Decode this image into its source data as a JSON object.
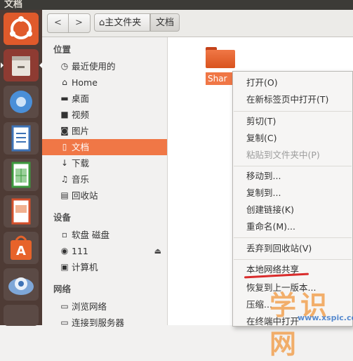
{
  "window": {
    "title": "文档"
  },
  "launcher": {
    "items": [
      {
        "name": "ubuntu-dash-icon",
        "bg": "#e05a2b"
      },
      {
        "name": "files-icon",
        "bg": "#8e3b32"
      },
      {
        "name": "chromium-icon",
        "bg": "#5b4a45"
      },
      {
        "name": "writer-icon",
        "bg": "#3e73b6"
      },
      {
        "name": "calc-icon",
        "bg": "#3d9a3e"
      },
      {
        "name": "impress-icon",
        "bg": "#d4502c"
      },
      {
        "name": "software-center-icon",
        "bg": "#e7632a"
      },
      {
        "name": "system-settings-icon",
        "bg": "#7ea7d8"
      }
    ]
  },
  "toolbar": {
    "back": "<",
    "forward": ">",
    "breadcrumb_home": "主文件夹",
    "breadcrumb_current": "文档"
  },
  "sidebar": {
    "places_header": "位置",
    "devices_header": "设备",
    "network_header": "网络",
    "places": [
      {
        "icon": "◷",
        "label": "最近使用的"
      },
      {
        "icon": "⌂",
        "label": "Home"
      },
      {
        "icon": "▬",
        "label": "桌面"
      },
      {
        "icon": "■",
        "label": "视频"
      },
      {
        "icon": "◙",
        "label": "图片"
      },
      {
        "icon": "▯",
        "label": "文档"
      },
      {
        "icon": "↓",
        "label": "下载"
      },
      {
        "icon": "♫",
        "label": "音乐"
      },
      {
        "icon": "▤",
        "label": "回收站"
      }
    ],
    "devices": [
      {
        "icon": "▫",
        "label": "软盘 磁盘"
      },
      {
        "icon": "◉",
        "label": "111"
      },
      {
        "icon": "▣",
        "label": "计算机"
      }
    ],
    "network": [
      {
        "icon": "▭",
        "label": "浏览网络"
      },
      {
        "icon": "▭",
        "label": "连接到服务器"
      }
    ],
    "eject": "⏏"
  },
  "content": {
    "folder_label": "Shar"
  },
  "context_menu": {
    "items": [
      {
        "label": "打开(O)",
        "disabled": false
      },
      {
        "label": "在新标签页中打开(T)",
        "disabled": false
      },
      {
        "label": "剪切(T)",
        "disabled": false
      },
      {
        "label": "复制(C)",
        "disabled": false
      },
      {
        "label": "粘贴到文件夹中(P)",
        "disabled": true
      },
      {
        "label": "移动到...",
        "disabled": false
      },
      {
        "label": "复制到...",
        "disabled": false
      },
      {
        "label": "创建链接(K)",
        "disabled": false
      },
      {
        "label": "重命名(M)...",
        "disabled": false
      },
      {
        "label": "丢弃到回收站(V)",
        "disabled": false
      },
      {
        "label": "本地网络共享",
        "disabled": false
      },
      {
        "label": "恢复到上一版本...",
        "disabled": false
      },
      {
        "label": "压缩...",
        "disabled": false
      },
      {
        "label": "在终端中打开",
        "disabled": false
      }
    ]
  },
  "watermark": {
    "big": "学识网",
    "small": "www.xspic.com"
  },
  "colors": {
    "accent": "#f07746",
    "launcher_bg": "#4e3b35",
    "underline": "#d92b2b"
  }
}
